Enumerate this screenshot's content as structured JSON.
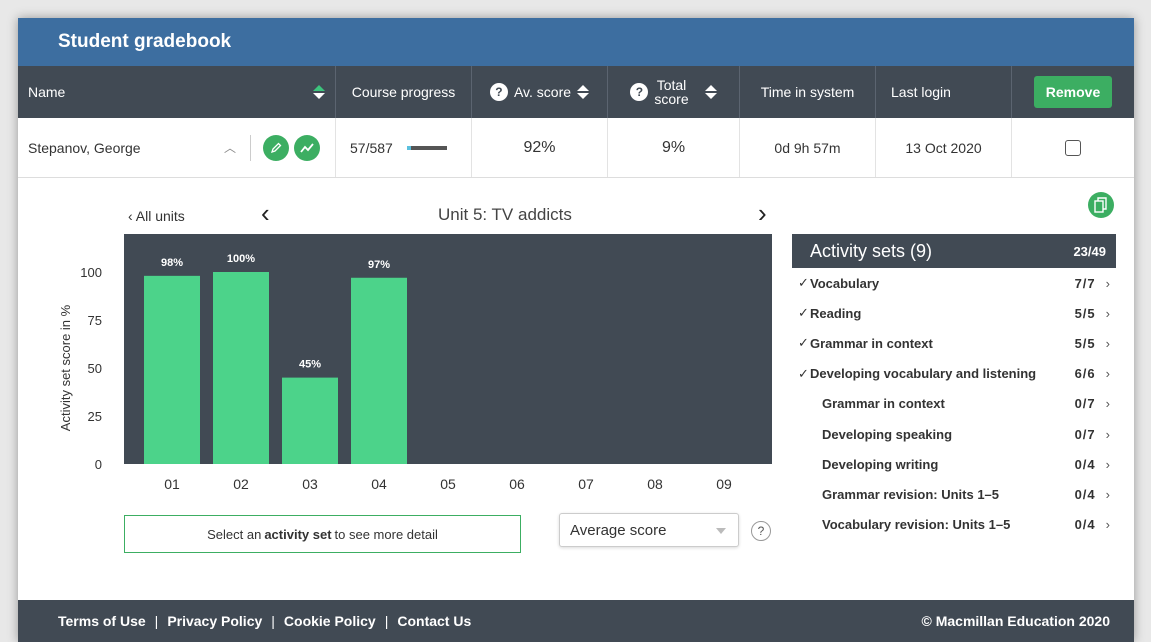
{
  "app": {
    "title": "Student gradebook"
  },
  "table": {
    "headers": {
      "name": "Name",
      "progress": "Course progress",
      "avg": "Av. score",
      "total_line1": "Total",
      "total_line2": "score",
      "time": "Time in system",
      "last": "Last login",
      "remove": "Remove"
    },
    "row": {
      "name": "Stepanov, George",
      "progress": "57/587",
      "progress_fraction": 0.097,
      "avg": "92%",
      "total": "9%",
      "time": "0d 9h 57m",
      "last": "13 Oct 2020"
    }
  },
  "detail": {
    "all_units": "All units",
    "unit_title": "Unit 5: TV addicts",
    "hint_pre": "Select an",
    "hint_bold": "activity set",
    "hint_post": "to see more detail",
    "select_value": "Average score"
  },
  "chart_data": {
    "type": "bar",
    "categories": [
      "01",
      "02",
      "03",
      "04",
      "05",
      "06",
      "07",
      "08",
      "09"
    ],
    "values": [
      98,
      100,
      45,
      97,
      null,
      null,
      null,
      null,
      null
    ],
    "labels": [
      "98%",
      "100%",
      "45%",
      "97%",
      "",
      "",
      "",
      "",
      ""
    ],
    "ylabel": "Activity set score in %",
    "ylim": [
      0,
      100
    ],
    "yticks": [
      0,
      25,
      50,
      75,
      100
    ],
    "colors": {
      "bar": "#4cd38a",
      "background": "#414a54"
    }
  },
  "activity_sets": {
    "title": "Activity sets (9)",
    "count": "23/49",
    "items": [
      {
        "label": "Vocabulary",
        "score": "7/7",
        "done": true
      },
      {
        "label": "Reading",
        "score": "5/5",
        "done": true
      },
      {
        "label": "Grammar in context",
        "score": "5/5",
        "done": true
      },
      {
        "label": "Developing vocabulary and listening",
        "score": "6/6",
        "done": true
      },
      {
        "label": "Grammar in context",
        "score": "0/7",
        "done": false
      },
      {
        "label": "Developing speaking",
        "score": "0/7",
        "done": false
      },
      {
        "label": "Developing writing",
        "score": "0/4",
        "done": false
      },
      {
        "label": "Grammar revision: Units 1–5",
        "score": "0/4",
        "done": false
      },
      {
        "label": "Vocabulary revision: Units 1–5",
        "score": "0/4",
        "done": false
      }
    ]
  },
  "footer": {
    "links": [
      "Terms of Use",
      "Privacy Policy",
      "Cookie Policy",
      "Contact Us"
    ],
    "copyright": "© Macmillan Education 2020"
  }
}
